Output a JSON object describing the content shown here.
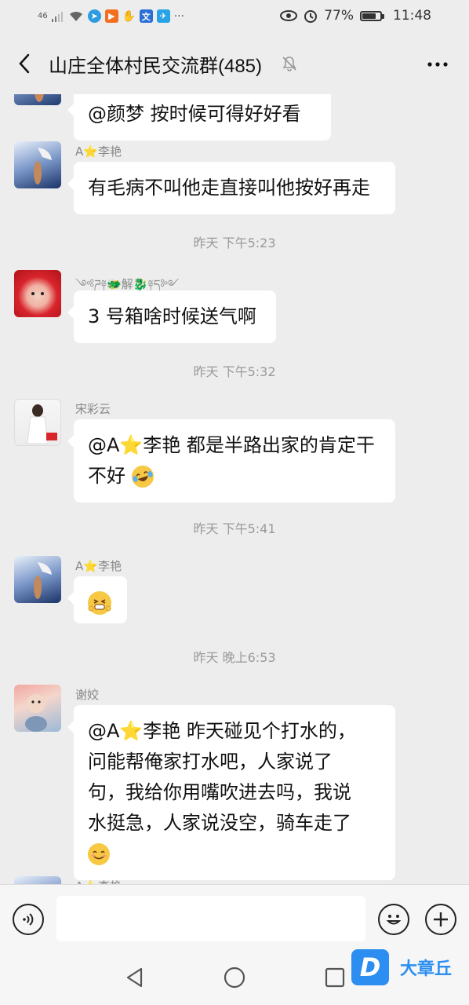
{
  "status_bar": {
    "network": "46",
    "battery": "77%",
    "battery_level": 0.77,
    "time": "11:48"
  },
  "header": {
    "title": "山庄全体村民交流群(485)"
  },
  "messages": [
    {
      "sender": "",
      "text": "@颜梦  按时候可得好好看"
    },
    {
      "sender": "A⭐李艳",
      "text": "有毛病不叫他走直接叫他按好再走"
    },
    {
      "time": "昨天 下午5:23"
    },
    {
      "sender": "༺ཌ༈🐲解🐉༈ད༻",
      "text": "3 号箱啥时候送气啊"
    },
    {
      "time": "昨天 下午5:32"
    },
    {
      "sender": "宋彩云",
      "text_line1": "@A⭐李艳  都是半路出家的肯定干",
      "text_line2": "不好"
    },
    {
      "time": "昨天 下午5:41"
    },
    {
      "sender": "A⭐李艳",
      "emoji": "grin-emoji"
    },
    {
      "time": "昨天 晚上6:53"
    },
    {
      "sender": "谢姣",
      "lines": [
        "@A⭐李艳 昨天碰见个打水的，",
        "问能帮俺家打水吧，人家说了",
        "句，我给你用嘴吹进去吗，我说",
        "水挺急，人家说没空，骑车走了"
      ]
    }
  ],
  "next_sender_partial": "A⭐李艳",
  "watermark": {
    "letter": "D",
    "text": "大章丘"
  },
  "colors": {
    "background": "#ededed",
    "bubble": "#ffffff",
    "meta_text": "#999999",
    "watermark": "#2b8ef0"
  }
}
